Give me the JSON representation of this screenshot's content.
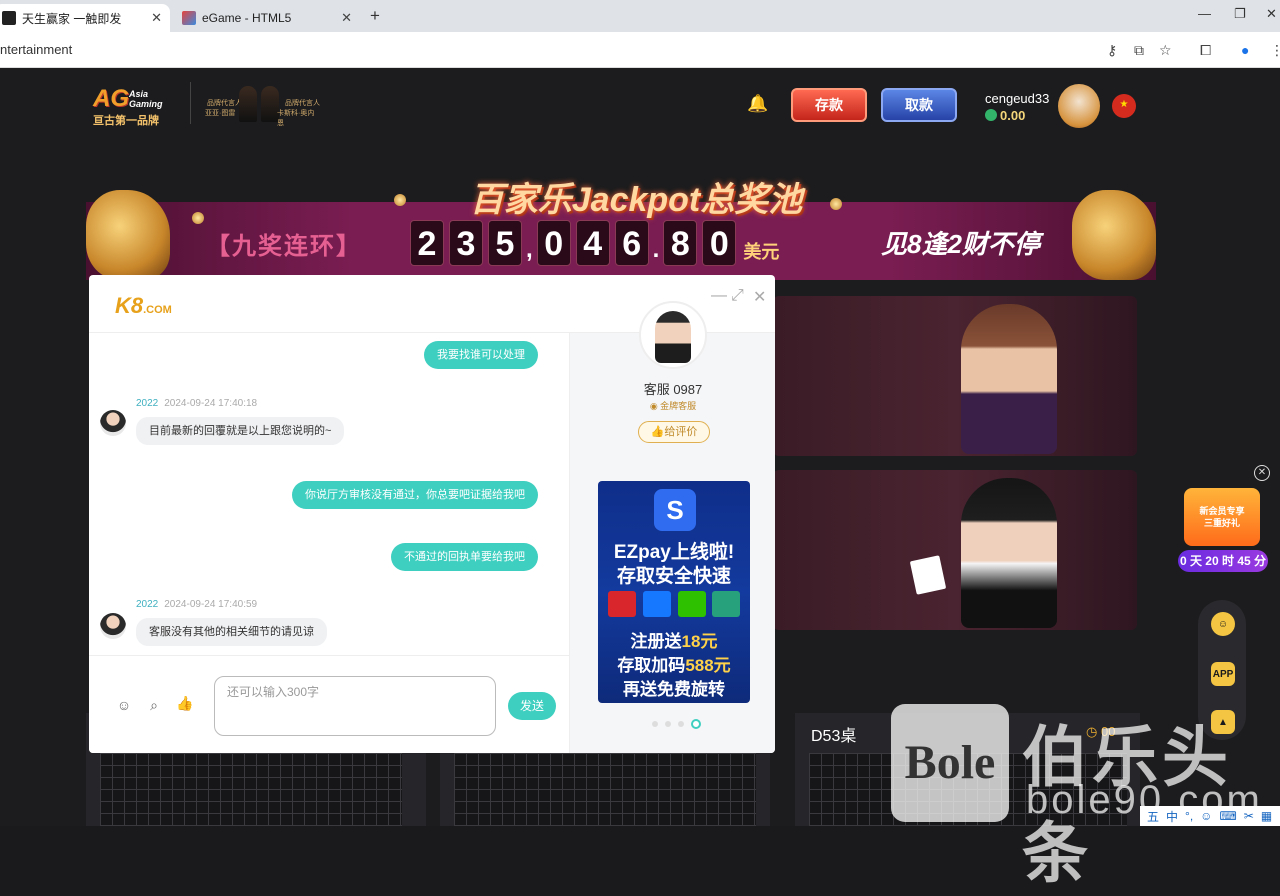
{
  "browser": {
    "tabs": [
      {
        "title": "天生赢家 一触即发",
        "active": true
      },
      {
        "title": "eGame - HTML5",
        "active": false
      }
    ],
    "new_tab": "+",
    "url_text": "ntertainment",
    "window_controls": [
      "minimize-icon",
      "restore-icon",
      "close-icon"
    ]
  },
  "header": {
    "logo_ag": "AG",
    "logo_sub": "Asia Gaming",
    "logo_cn": "亘古第一品牌",
    "ambassador_left": "品牌代言人",
    "ambassador_left_name": "亚亚·图雷",
    "ambassador_right": "品牌代言人",
    "ambassador_right_name": "卡斯科·奥内恩",
    "deposit_label": "存款",
    "withdraw_label": "取款",
    "username": "cengeud33",
    "balance": "0.00"
  },
  "jackpot": {
    "title": "百家乐Jackpot总奖池",
    "left_slogan": "【九奖连环】",
    "right_slogan": "见8逢2财不停",
    "digits": [
      "2",
      "3",
      "5",
      ",",
      "0",
      "4",
      "6",
      ".",
      "8",
      "0"
    ],
    "currency": "美元"
  },
  "chat": {
    "brand": "K8",
    "brand_suffix": ".COM",
    "messages": [
      {
        "side": "out",
        "text": "我要找谁可以处理"
      },
      {
        "side": "in",
        "who": "2022",
        "time": "2024-09-24 17:40:18",
        "text": "目前最新的回覆就是以上跟您说明的~"
      },
      {
        "side": "out",
        "text": "你说厅方审核没有通过，你总要吧证据给我吧"
      },
      {
        "side": "out",
        "text": "不通过的回执单要给我吧"
      },
      {
        "side": "in",
        "who": "2022",
        "time": "2024-09-24 17:40:59",
        "text": "客服没有其他的相关细节的请见谅"
      }
    ],
    "input_placeholder": "还可以输入300字",
    "send_label": "发送",
    "agent_name": "客服 0987",
    "agent_tag": "金牌客服",
    "rate_label": "给评价",
    "ad": {
      "logo": "S",
      "line1": "EZpay上线啦!",
      "line2": "存取安全快速",
      "line3_pre": "注册送",
      "line3_hl": "18元",
      "line4_pre": "存取加码",
      "line4_hl": "588元",
      "line5": "再送免费旋转"
    }
  },
  "lobby": {
    "table_name": "D53桌",
    "timer": "00"
  },
  "promo": {
    "line1": "新会员专享",
    "line2": "三重好礼",
    "countdown": "0 天 20 时 45 分"
  },
  "rail": {
    "app_label": "APP"
  },
  "watermark": {
    "box": "Bole",
    "cn": "伯乐头条",
    "url": "bole90.com"
  },
  "ime": [
    "五",
    "中",
    "°,",
    "☺",
    "⌨",
    "✂",
    "▦",
    "👕"
  ]
}
